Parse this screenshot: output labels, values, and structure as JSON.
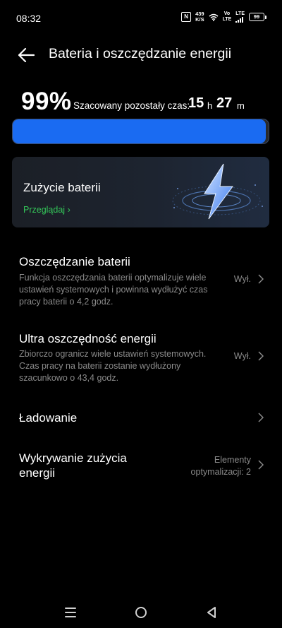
{
  "status": {
    "time": "08:32",
    "nfc": "N",
    "speed_value": "439",
    "speed_unit": "K/S",
    "volte_top": "Vo",
    "volte_bottom": "LTE",
    "lte": "LTE",
    "battery_level": "99"
  },
  "header": {
    "title": "Bateria i oszczędzanie energii"
  },
  "battery": {
    "percent_text": "99%",
    "level_fraction": 0.99,
    "estimate_label": "Szacowany pozostały czas:",
    "hours": "15",
    "hours_unit": "h",
    "minutes": "27",
    "minutes_unit": "m",
    "accent_color": "#1a6bf2"
  },
  "usage_card": {
    "title": "Zużycie baterii",
    "link": "Przeglądaj",
    "link_color": "#34c759",
    "icon": "lightning-bolt-icon"
  },
  "settings": [
    {
      "title": "Oszczędzanie baterii",
      "description": "Funkcja oszczędzania baterii optymalizuje wiele ustawień systemowych i powinna wydłużyć czas pracy baterii o 4,2 godz.",
      "value": "Wył."
    },
    {
      "title": "Ultra oszczędność energii",
      "description": "Zbiorczo ogranicz wiele ustawień systemowych. Czas pracy na baterii zostanie wydłużony szacunkowo o 43,4 godz.",
      "value": "Wył."
    },
    {
      "title": "Ładowanie"
    },
    {
      "title_line1": "Wykrywanie zużycia",
      "title_line2": "energii",
      "value_line1": "Elementy",
      "value_line2": "optymalizacji: 2"
    }
  ]
}
